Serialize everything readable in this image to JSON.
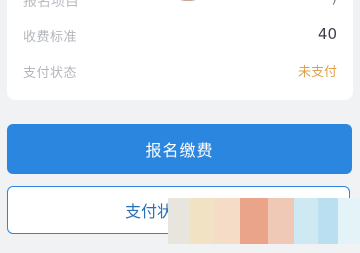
{
  "info": {
    "top_row_label": "报名项目",
    "fee_label": "收费标准",
    "fee_value": "40",
    "status_label": "支付状态",
    "status_value": "未支付"
  },
  "actions": {
    "register_pay_label": "报名缴费",
    "payment_status_label": "支付状"
  },
  "colors": {
    "primary": "#2b86df",
    "status_unpaid": "#e0a34a",
    "background": "#f1f2f4"
  },
  "icons": {
    "emoji_sticker": "emoji-sticker-icon"
  }
}
